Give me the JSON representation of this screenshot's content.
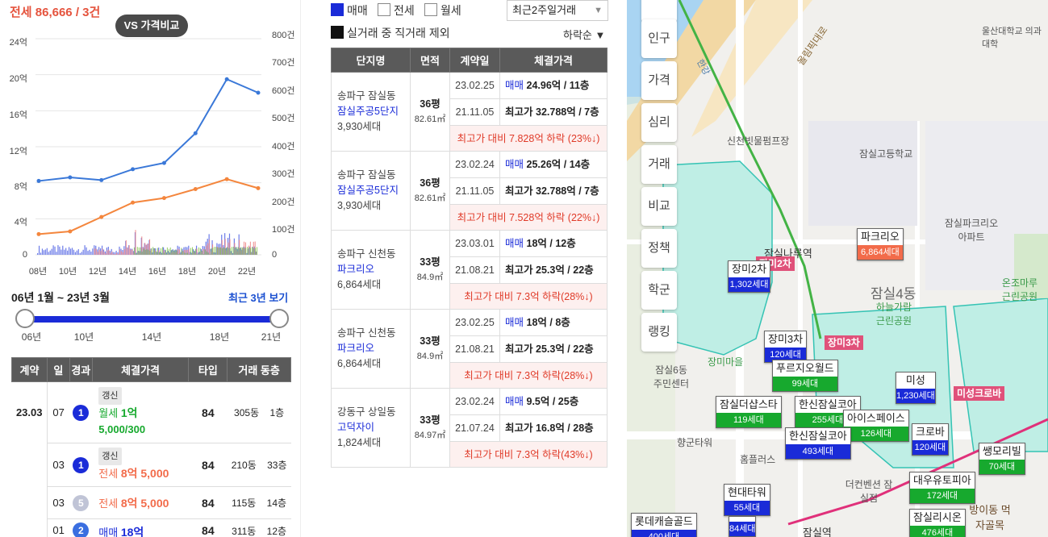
{
  "left": {
    "headline": "전세 86,666 / 3건",
    "vs_button": "VS 가격비교",
    "y_left_ticks": [
      "24억",
      "20억",
      "16억",
      "12억",
      "8억",
      "4억",
      "0"
    ],
    "y_right_ticks": [
      "800건",
      "700건",
      "600건",
      "500건",
      "400건",
      "300건",
      "200건",
      "100건",
      "0"
    ],
    "x_ticks": [
      "08년",
      "10년",
      "12년",
      "14년",
      "16년",
      "18년",
      "20년",
      "22년"
    ],
    "range_label": "06년 1월 ~ 23년 3월",
    "range_link": "최근 3년 보기",
    "slider_ticks": [
      "06년",
      "10년",
      "14년",
      "18년",
      "21년"
    ],
    "table_headers": [
      "계약",
      "일",
      "경과",
      "체결가격",
      "타입",
      "거래 동층"
    ],
    "rows": [
      {
        "month": "23.03",
        "day": "07",
        "badge": "1",
        "badge_color": "#1a2bd8",
        "tag": "갱신",
        "kind": "월세",
        "price": "1억",
        "price2": "5,000/300",
        "kind_color": "#17a92e",
        "type": "84",
        "dong": "305동",
        "floor": "1층"
      },
      {
        "month": "",
        "day": "03",
        "badge": "1",
        "badge_color": "#1a2bd8",
        "tag": "갱신",
        "kind": "전세",
        "price": "8억 5,000",
        "price2": "",
        "kind_color": "#f26b4a",
        "type": "84",
        "dong": "210동",
        "floor": "33층"
      },
      {
        "month": "",
        "day": "03",
        "badge": "5",
        "badge_color": "#c0c4d6",
        "tag": "",
        "kind": "전세",
        "price": "8억 5,000",
        "price2": "",
        "kind_color": "#f26b4a",
        "type": "84",
        "dong": "115동",
        "floor": "14층"
      },
      {
        "month": "",
        "day": "01",
        "badge": "2",
        "badge_color": "#3a6ee0",
        "tag": "",
        "kind": "매매",
        "price": "18억",
        "price2": "",
        "kind_color": "#1a2bd8",
        "type": "84",
        "dong": "311동",
        "floor": "12층"
      }
    ],
    "colors": {
      "sale": "#3a78d8",
      "jeonse": "#f4863d",
      "volume_sale": "#6b7be8",
      "volume_jeonse": "#f08a8a",
      "volume_rent": "#7cc043"
    }
  },
  "chart_data": {
    "type": "line",
    "title": "",
    "x": [
      "08년",
      "10년",
      "12년",
      "14년",
      "16년",
      "18년",
      "20년",
      "22년"
    ],
    "ylim_left": [
      0,
      24
    ],
    "ylim_right": [
      0,
      800
    ],
    "series": [
      {
        "values": [
          8.2,
          8.6,
          8.3,
          9.5,
          10.2,
          13.5,
          19.5,
          18.0
        ]
      },
      {
        "values": [
          2.3,
          2.6,
          4.2,
          5.8,
          6.3,
          7.3,
          8.4,
          7.4
        ]
      }
    ]
  },
  "mid": {
    "filters": [
      {
        "label": "매매",
        "checked": true
      },
      {
        "label": "전세",
        "checked": false
      },
      {
        "label": "월세",
        "checked": false
      }
    ],
    "exclude_label": "실거래 중 직거래 제외",
    "period_select": "최근2주일거래",
    "sort_label": "하락순 ▼",
    "table_headers": [
      "단지명",
      "면적",
      "계약일",
      "체결가격"
    ],
    "groups": [
      {
        "district": "송파구 잠실동",
        "name": "잠실주공5단지",
        "households": "3,930세대",
        "pyeong": "36평",
        "area": "82.61㎡",
        "rows": [
          {
            "date": "23.02.25",
            "kind": "매매",
            "price": "24.96억 / 11층"
          },
          {
            "date": "21.11.05",
            "kind": "최고가",
            "price": "32.788억 / 7층"
          }
        ],
        "drop": "최고가 대비 7.828억 하락 (23%↓)"
      },
      {
        "district": "송파구 잠실동",
        "name": "잠실주공5단지",
        "households": "3,930세대",
        "pyeong": "36평",
        "area": "82.61㎡",
        "rows": [
          {
            "date": "23.02.24",
            "kind": "매매",
            "price": "25.26억 / 14층"
          },
          {
            "date": "21.11.05",
            "kind": "최고가",
            "price": "32.788억 / 7층"
          }
        ],
        "drop": "최고가 대비 7.528억 하락 (22%↓)"
      },
      {
        "district": "송파구 신천동",
        "name": "파크리오",
        "households": "6,864세대",
        "pyeong": "33평",
        "area": "84.9㎡",
        "rows": [
          {
            "date": "23.03.01",
            "kind": "매매",
            "price": "18억 / 12층"
          },
          {
            "date": "21.08.21",
            "kind": "최고가",
            "price": "25.3억 / 22층"
          }
        ],
        "drop": "최고가 대비 7.3억 하락(28%↓)"
      },
      {
        "district": "송파구 신천동",
        "name": "파크리오",
        "households": "6,864세대",
        "pyeong": "33평",
        "area": "84.9㎡",
        "rows": [
          {
            "date": "23.02.25",
            "kind": "매매",
            "price": "18억 / 8층"
          },
          {
            "date": "21.08.21",
            "kind": "최고가",
            "price": "25.3억 / 22층"
          }
        ],
        "drop": "최고가 대비 7.3억 하락(28%↓)"
      },
      {
        "district": "강동구 상일동",
        "name": "고덕자이",
        "households": "1,824세대",
        "pyeong": "33평",
        "area": "84.97㎡",
        "rows": [
          {
            "date": "23.02.24",
            "kind": "매매",
            "price": "9.5억 / 25층"
          },
          {
            "date": "21.07.24",
            "kind": "최고가",
            "price": "16.8억 / 28층"
          }
        ],
        "drop": "최고가 대비 7.3억 하락(43%↓)"
      }
    ]
  },
  "map": {
    "side_buttons": [
      "인구",
      "가격",
      "심리",
      "거래",
      "비교",
      "정책",
      "학군",
      "랭킹"
    ],
    "places": [
      "울산대학교 의과대학",
      "신천빗물펌프장",
      "잠실고등학교",
      "잠실파크리오 아파트",
      "잠실나루역",
      "잠실4동",
      "하늘가람 근린공원",
      "온조마루 근린공원",
      "장미마을",
      "잠실6동 주민센터",
      "향군타워",
      "홈플러스",
      "더컨벤션 잠실점",
      "방이동 먹자골목",
      "잠실역",
      "올림픽대로",
      "한강"
    ],
    "pins": [
      {
        "name": "파크리오",
        "count": "6,864세대",
        "color": "o"
      },
      {
        "name": "장미2차",
        "count": "1,302세대",
        "color": "b"
      },
      {
        "name": "장미3차",
        "count": "120세대",
        "color": "b"
      },
      {
        "name": "푸르지오월드",
        "count": "99세대",
        "color": "g"
      },
      {
        "name": "잠실더샵스타",
        "count": "119세대",
        "color": "g"
      },
      {
        "name": "한신잠실코아",
        "count": "255세대",
        "color": "g"
      },
      {
        "name": "아이스페이스",
        "count": "126세대",
        "color": "g"
      },
      {
        "name": "한신잠실코아",
        "count": "493세대",
        "color": "b"
      },
      {
        "name": "미성",
        "count": "1,230세대",
        "color": "b"
      },
      {
        "name": "크로바",
        "count": "120세대",
        "color": "b"
      },
      {
        "name": "쌩모리빌",
        "count": "70세대",
        "color": "g"
      },
      {
        "name": "대우유토피아",
        "count": "172세대",
        "color": "g"
      },
      {
        "name": "현대타워",
        "count": "55세대",
        "color": "b"
      },
      {
        "name": "잠실리시온",
        "count": "476세대",
        "color": "g"
      },
      {
        "name": "롯데캐슬골드",
        "count": "400세대",
        "color": "b"
      },
      {
        "name": "",
        "count": "84세대",
        "color": "b"
      }
    ],
    "pink_labels": [
      "장미2차",
      "장미3차",
      "미성크로바"
    ]
  }
}
